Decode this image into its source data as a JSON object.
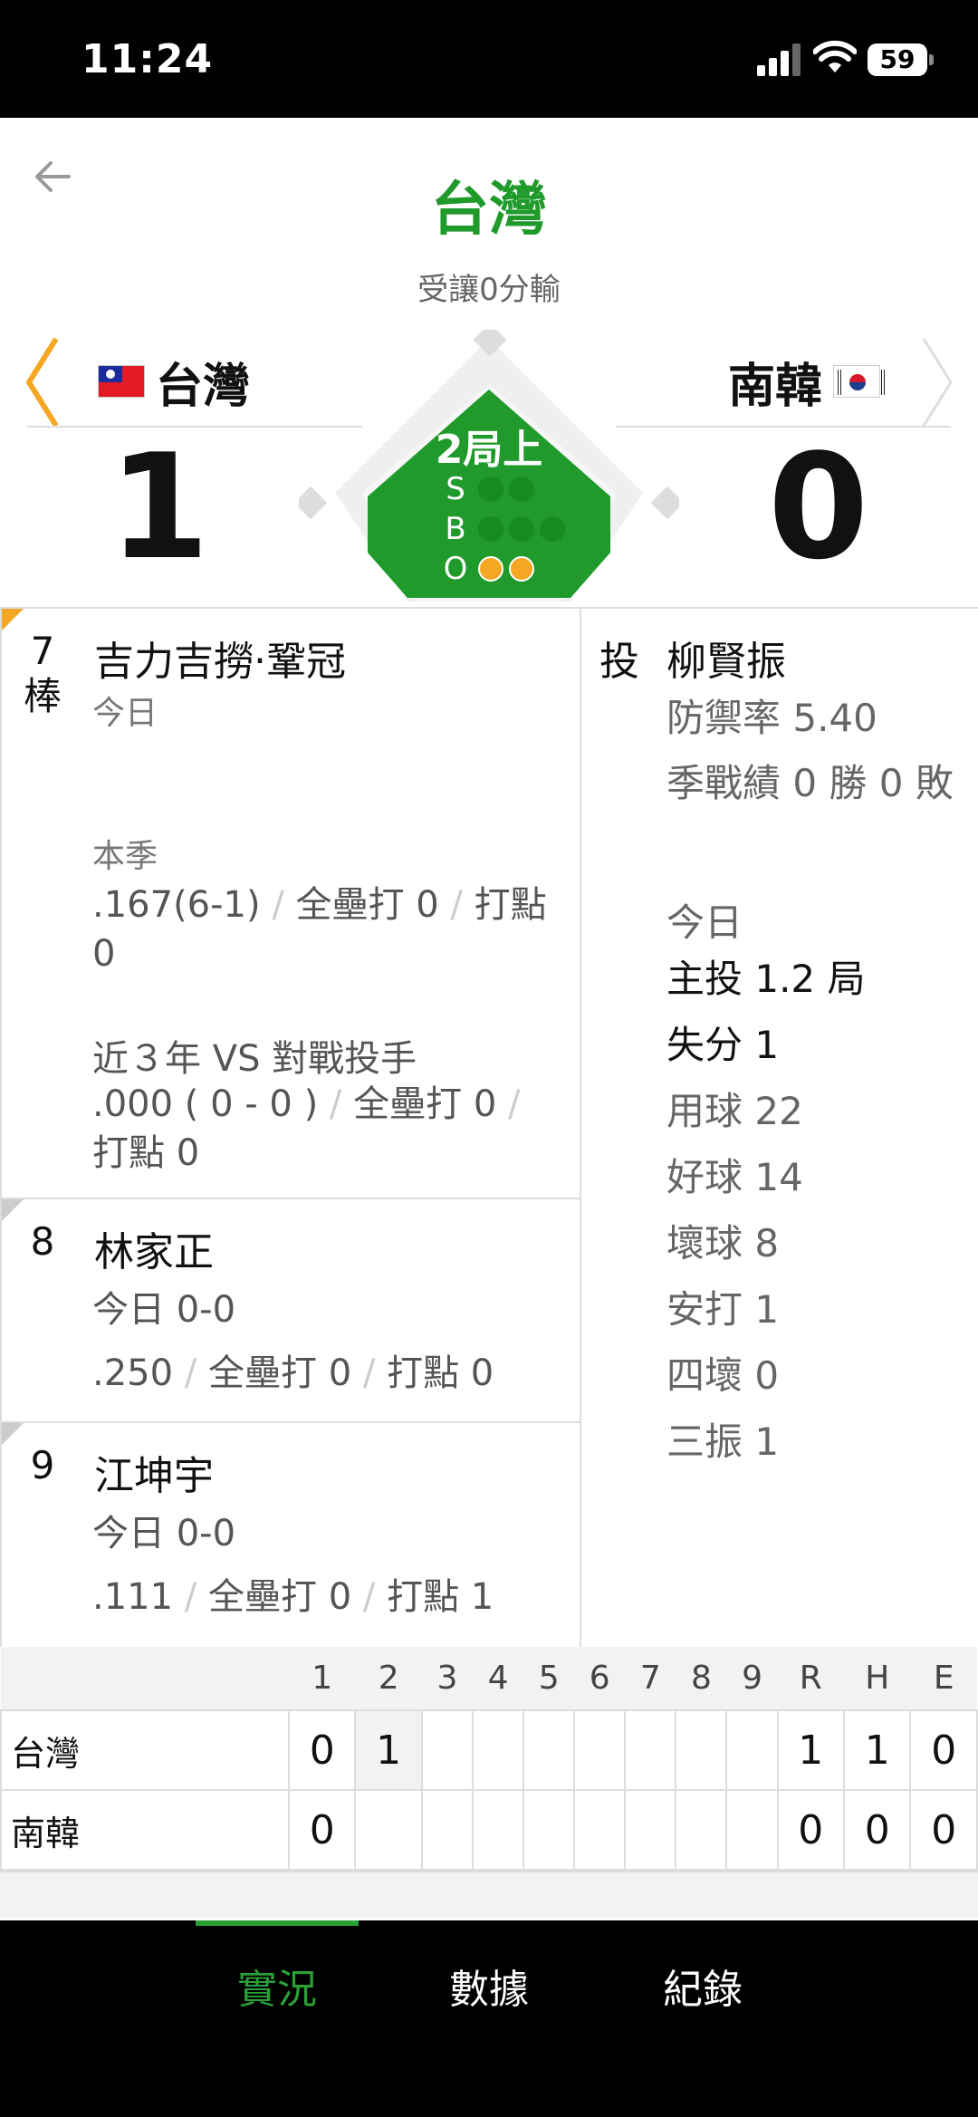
{
  "status_bar": {
    "time": "11:24",
    "battery": "59"
  },
  "header": {
    "title": "台灣",
    "subtitle": "受讓0分輸"
  },
  "teams": {
    "away": {
      "name": "台灣",
      "score": "1"
    },
    "home": {
      "name": "南韓",
      "score": "0"
    }
  },
  "game_state": {
    "inning": "2局上",
    "labels": {
      "s": "S",
      "b": "B",
      "o": "O"
    },
    "strikes": 0,
    "balls": 0,
    "outs": 2
  },
  "batters": [
    {
      "order": "7\n棒",
      "name": "吉力吉撈‧鞏冠",
      "today_label": "今日",
      "season_label": "本季",
      "season_avg": ".167(6-1)",
      "season_hr": "全壘打 0",
      "season_rbi": "打點 0",
      "vs_label": "近３年 VS 對戰投手",
      "vs_avg": ".000 ( 0 - 0 )",
      "vs_hr": "全壘打 0",
      "vs_rbi": "打點 0"
    },
    {
      "order": "8",
      "name": "林家正",
      "today": "今日 0-0",
      "avg": ".250",
      "hr": "全壘打 0",
      "rbi": "打點 0"
    },
    {
      "order": "9",
      "name": "江坤宇",
      "today": "今日 0-0",
      "avg": ".111",
      "hr": "全壘打 0",
      "rbi": "打點 1"
    }
  ],
  "pitcher": {
    "tag": "投",
    "name": "柳賢振",
    "era": "防禦率 5.40",
    "record": "季戰績 0 勝 0 敗",
    "today_label": "今日",
    "ip": "主投 1.2 局",
    "runs": "失分 1",
    "pitches": "用球 22",
    "strikes": "好球 14",
    "balls": "壞球 8",
    "hits": "安打 1",
    "walks": "四壞 0",
    "strikeouts": "三振 1"
  },
  "linescore": {
    "headers": [
      "1",
      "2",
      "3",
      "4",
      "5",
      "6",
      "7",
      "8",
      "9",
      "R",
      "H",
      "E"
    ],
    "rows": [
      {
        "team": "台灣",
        "innings": [
          "0",
          "1",
          "",
          "",
          "",
          "",
          "",
          "",
          ""
        ],
        "r": "1",
        "h": "1",
        "e": "0"
      },
      {
        "team": "南韓",
        "innings": [
          "0",
          "",
          "",
          "",
          "",
          "",
          "",
          "",
          ""
        ],
        "r": "0",
        "h": "0",
        "e": "0"
      }
    ]
  },
  "tabs": [
    {
      "label": "實況"
    },
    {
      "label": "數據"
    },
    {
      "label": "紀錄"
    }
  ]
}
